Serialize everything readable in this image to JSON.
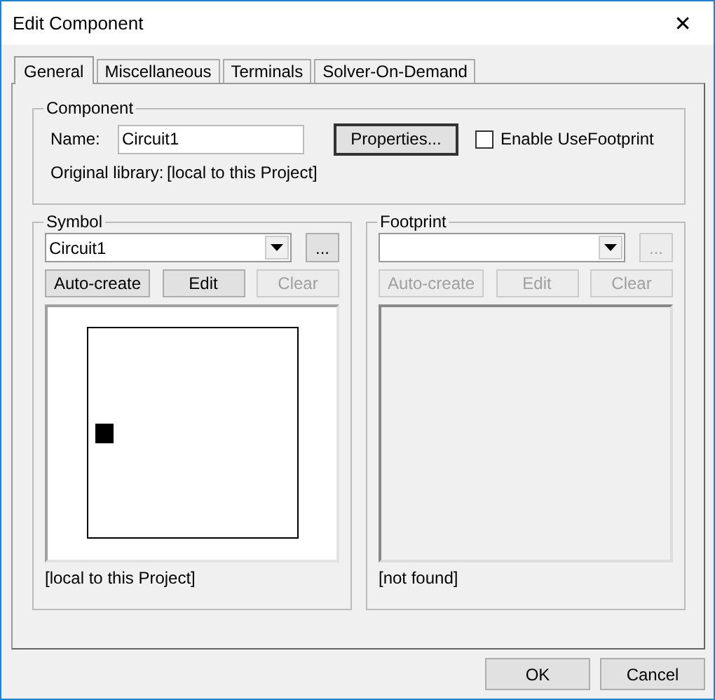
{
  "window": {
    "title": "Edit Component",
    "close": "✕"
  },
  "tabs": [
    {
      "label": "General",
      "selected": true
    },
    {
      "label": "Miscellaneous",
      "selected": false
    },
    {
      "label": "Terminals",
      "selected": false
    },
    {
      "label": "Solver-On-Demand",
      "selected": false
    }
  ],
  "component": {
    "legend": "Component",
    "name_label": "Name:",
    "name_value": "Circuit1",
    "properties_button": "Properties...",
    "enable_footprint": {
      "label": "Enable UseFootprint",
      "checked": false
    },
    "library_label": "Original library:",
    "library_value": "[local to this Project]"
  },
  "panels": [
    {
      "legend": "Symbol",
      "value": "Circuit1",
      "browse": {
        "label": "...",
        "disabled": false
      },
      "buttons": [
        {
          "label": "Auto-create",
          "disabled": false
        },
        {
          "label": "Edit",
          "disabled": false
        },
        {
          "label": "Clear",
          "disabled": true
        }
      ],
      "preview": {
        "kind": "symbol"
      },
      "caption": "[local to this Project]"
    },
    {
      "legend": "Footprint",
      "browse": {
        "label": "...",
        "disabled": true
      },
      "buttons": [
        {
          "label": "Auto-create",
          "disabled": true
        },
        {
          "label": "Edit",
          "disabled": true
        },
        {
          "label": "Clear",
          "disabled": true
        }
      ],
      "preview": {
        "kind": "empty"
      },
      "caption": "[not found]"
    }
  ],
  "buttons": [
    "OK",
    "Cancel"
  ]
}
